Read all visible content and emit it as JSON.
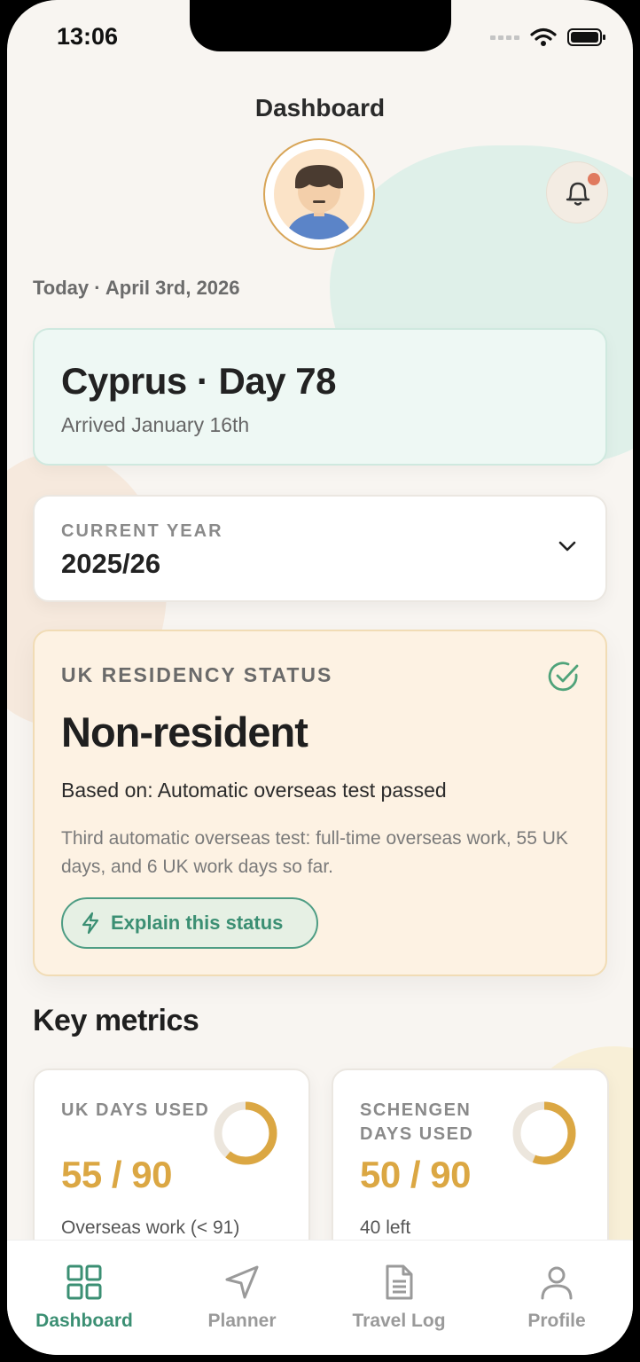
{
  "status_bar": {
    "time": "13:06"
  },
  "header": {
    "title": "Dashboard"
  },
  "date_line": "Today · April 3rd, 2026",
  "location": {
    "title": "Cyprus · Day 78",
    "subtitle": "Arrived January 16th"
  },
  "year_selector": {
    "label": "CURRENT YEAR",
    "value": "2025/26"
  },
  "residency": {
    "label": "UK RESIDENCY STATUS",
    "status": "Non-resident",
    "basis": "Based on: Automatic overseas test passed",
    "detail": "Third automatic overseas test: full-time overseas work, 55 UK days, and 6 UK work days so far.",
    "explain_label": "Explain this status"
  },
  "key_metrics": {
    "title": "Key metrics",
    "items": [
      {
        "label": "UK DAYS USED",
        "value": "55 / 90",
        "note": "Overseas work (< 91)",
        "progress": 0.61
      },
      {
        "label": "SCHENGEN DAYS USED",
        "value": "50 / 90",
        "note": "40 left",
        "progress": 0.56
      }
    ]
  },
  "tabs": [
    {
      "label": "Dashboard",
      "icon": "grid-icon",
      "active": true
    },
    {
      "label": "Planner",
      "icon": "navigation-icon",
      "active": false
    },
    {
      "label": "Travel Log",
      "icon": "document-icon",
      "active": false
    },
    {
      "label": "Profile",
      "icon": "user-icon",
      "active": false
    }
  ],
  "colors": {
    "accent": "#3b8f73",
    "gold": "#dba743",
    "notification": "#e07a5f"
  }
}
